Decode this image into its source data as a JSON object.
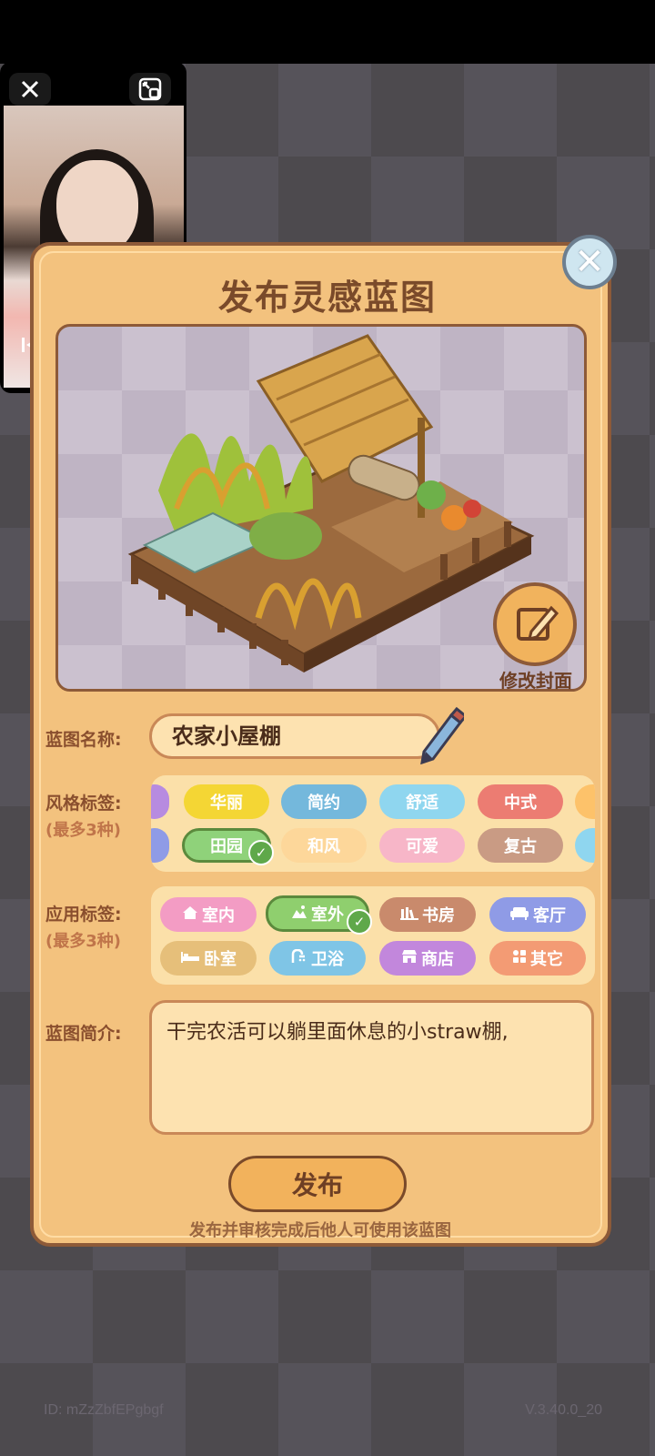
{
  "dialog": {
    "title": "发布灵感蓝图",
    "edit_cover_label": "修改封面",
    "name_label": "蓝图名称:",
    "name_value": "农家小屋棚",
    "style_label": "风格标签:",
    "style_sub": "(最多3种)",
    "style_tags": [
      {
        "label": "华丽",
        "color": "#f4d634",
        "selected": false
      },
      {
        "label": "简约",
        "color": "#74b8dc",
        "selected": false
      },
      {
        "label": "舒适",
        "color": "#8fd6ef",
        "selected": false
      },
      {
        "label": "中式",
        "color": "#ec7c72",
        "selected": false
      },
      {
        "label": "田园",
        "color": "#8fd27a",
        "selected": true
      },
      {
        "label": "和风",
        "color": "#fdd79a",
        "selected": false
      },
      {
        "label": "可爱",
        "color": "#f7b6c8",
        "selected": false
      },
      {
        "label": "复古",
        "color": "#c99b84",
        "selected": false
      }
    ],
    "app_label": "应用标签:",
    "app_sub": "(最多3种)",
    "app_tags": [
      {
        "label": "室内",
        "icon": "house-icon",
        "color": "#f39cc4",
        "selected": false
      },
      {
        "label": "室外",
        "icon": "outdoor-icon",
        "color": "#8fcf6e",
        "selected": true
      },
      {
        "label": "书房",
        "icon": "books-icon",
        "color": "#c98a6c",
        "selected": false
      },
      {
        "label": "客厅",
        "icon": "sofa-icon",
        "color": "#8f9be6",
        "selected": false
      },
      {
        "label": "卧室",
        "icon": "bed-icon",
        "color": "#e6bf7a",
        "selected": false
      },
      {
        "label": "卫浴",
        "icon": "shower-icon",
        "color": "#7fc5e6",
        "selected": false
      },
      {
        "label": "商店",
        "icon": "shop-icon",
        "color": "#c287dc",
        "selected": false
      },
      {
        "label": "其它",
        "icon": "grid-icon",
        "color": "#f39b74",
        "selected": false
      }
    ],
    "desc_label": "蓝图简介:",
    "desc_value": "干完农活可以躺里面休息的小straw棚,",
    "publish_label": "发布",
    "hint": "发布并审核完成后他人可使用该蓝图"
  },
  "footer": {
    "id_text": "ID: mZzZbfEPgbgf",
    "version": "V.3.40.0_20"
  },
  "video": {
    "prev_icon": "skip-previous-icon",
    "play_icon": "play-icon",
    "next_icon": "skip-next-icon"
  }
}
